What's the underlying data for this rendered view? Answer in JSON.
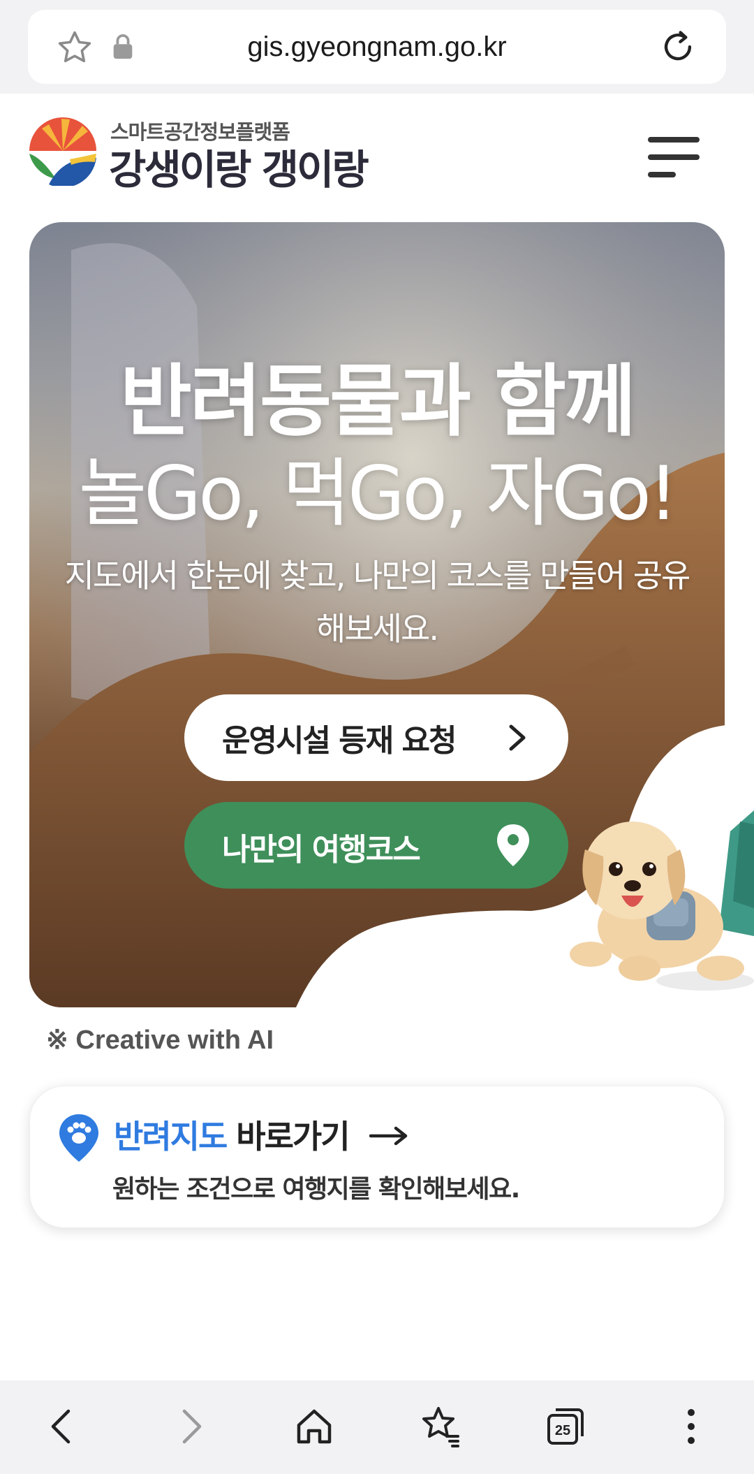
{
  "browser": {
    "url": "gis.gyeongnam.go.kr",
    "tabs_count": "25"
  },
  "header": {
    "logo_subtitle": "스마트공간정보플랫폼",
    "logo_title": "강생이랑 갱이랑"
  },
  "hero": {
    "title": "반려동물과 함께",
    "subtitle": "놀Go, 먹Go, 자Go!",
    "description": "지도에서 한눈에 찾고, 나만의 코스를 만들어 공유해보세요.",
    "request_button_label": "운영시설 등재 요청",
    "course_button_label": "나만의 여행코스"
  },
  "ai_note": "※ Creative with AI",
  "map_card": {
    "title_accent": "반려지도",
    "title_rest": " 바로가기",
    "description": "원하는 조건으로 여행지를 확인해보세요."
  },
  "colors": {
    "accent_green": "#3f8f5a",
    "accent_blue": "#2f7be0"
  }
}
